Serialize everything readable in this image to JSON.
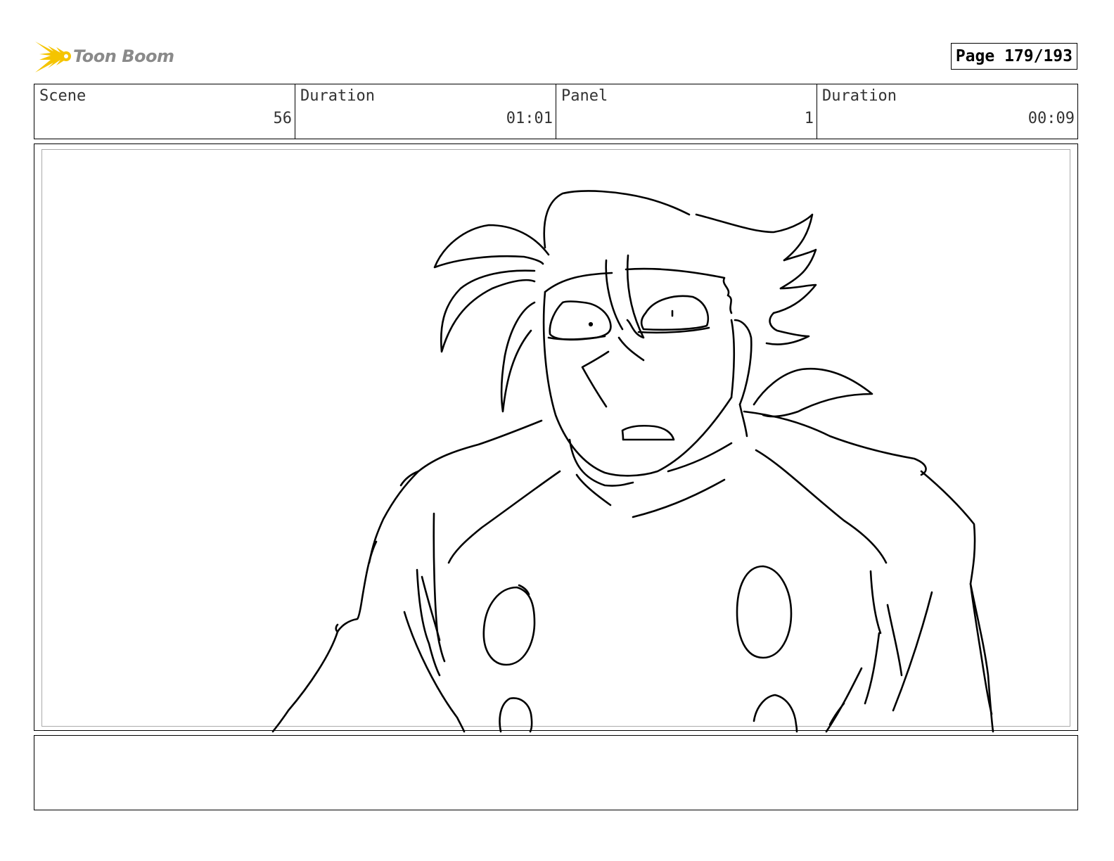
{
  "header": {
    "logo_text": "Toon Boom",
    "logo_icon": "toon-boom-burst-icon",
    "page_label": "Page 179/193"
  },
  "info": [
    {
      "label": "Scene",
      "value": "56"
    },
    {
      "label": "Duration",
      "value": "01:01"
    },
    {
      "label": "Panel",
      "value": "1"
    },
    {
      "label": "Duration",
      "value": "00:09"
    }
  ],
  "panel": {
    "drawing": "character-sketch"
  },
  "notes": {
    "text": ""
  },
  "colors": {
    "logo_yellow": "#f5c400",
    "logo_text": "#8a8a8a",
    "border": "#000000",
    "inner_border": "#aaaaaa"
  }
}
